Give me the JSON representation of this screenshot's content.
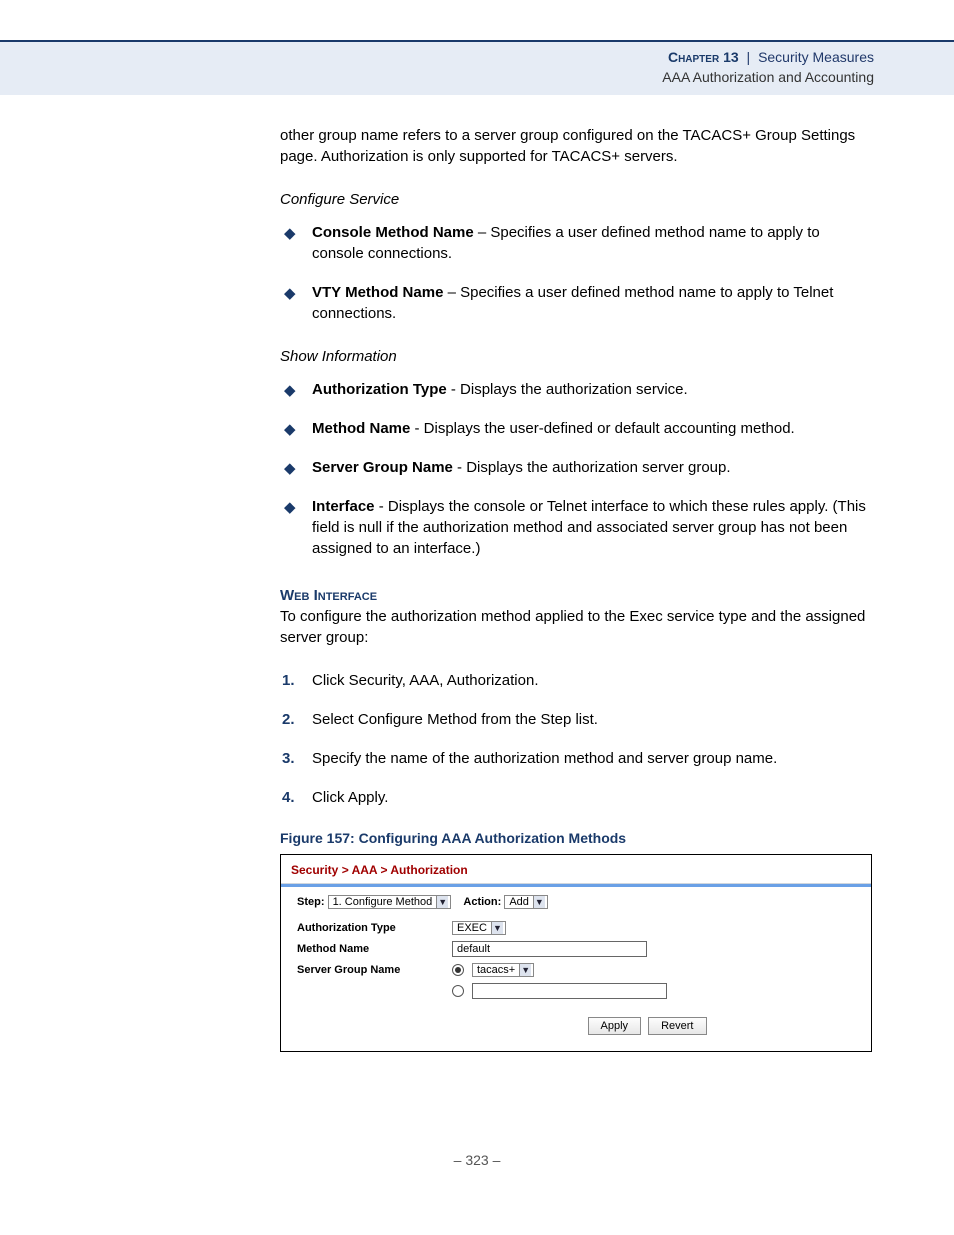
{
  "header": {
    "chapter": "Chapter 13",
    "chapterTitle": "Security Measures",
    "subtitle": "AAA Authorization and Accounting"
  },
  "intro": "other group name refers to a server group configured on the TACACS+ Group Settings page. Authorization is only supported for TACACS+ servers.",
  "configureService": {
    "title": "Configure Service",
    "items": [
      {
        "term": "Console Method Name",
        "desc": " – Specifies a user defined method name to apply to console connections."
      },
      {
        "term": "VTY Method Name",
        "desc": " – Specifies a user defined method name to apply to Telnet connections."
      }
    ]
  },
  "showInformation": {
    "title": "Show Information",
    "items": [
      {
        "term": "Authorization Type",
        "desc": " - Displays the authorization service."
      },
      {
        "term": "Method Name",
        "desc": " - Displays the user-defined or default accounting method."
      },
      {
        "term": "Server Group Name",
        "desc": " - Displays the authorization server group."
      },
      {
        "term": "Interface",
        "desc": " - Displays the console or Telnet interface to which these rules apply. (This field is null if the authorization method and associated server group has not been assigned to an interface.)"
      }
    ]
  },
  "webInterface": {
    "label": "Web Interface",
    "intro": "To configure the authorization method applied to the Exec service type and the assigned server group:",
    "steps": [
      "Click Security, AAA, Authorization.",
      "Select Configure Method from the Step list.",
      "Specify the name of the authorization method and server group name.",
      "Click Apply."
    ]
  },
  "figure": {
    "caption": "Figure 157:  Configuring AAA Authorization Methods",
    "breadcrumb": "Security > AAA > Authorization",
    "stepLabel": "Step:",
    "stepValue": "1. Configure Method",
    "actionLabel": "Action:",
    "actionValue": "Add",
    "fields": {
      "authType": {
        "label": "Authorization Type",
        "value": "EXEC"
      },
      "methodName": {
        "label": "Method Name",
        "value": "default"
      },
      "serverGroup": {
        "label": "Server Group Name",
        "value": "tacacs+"
      }
    },
    "buttons": {
      "apply": "Apply",
      "revert": "Revert"
    }
  },
  "footer": {
    "page": "–  323  –"
  }
}
